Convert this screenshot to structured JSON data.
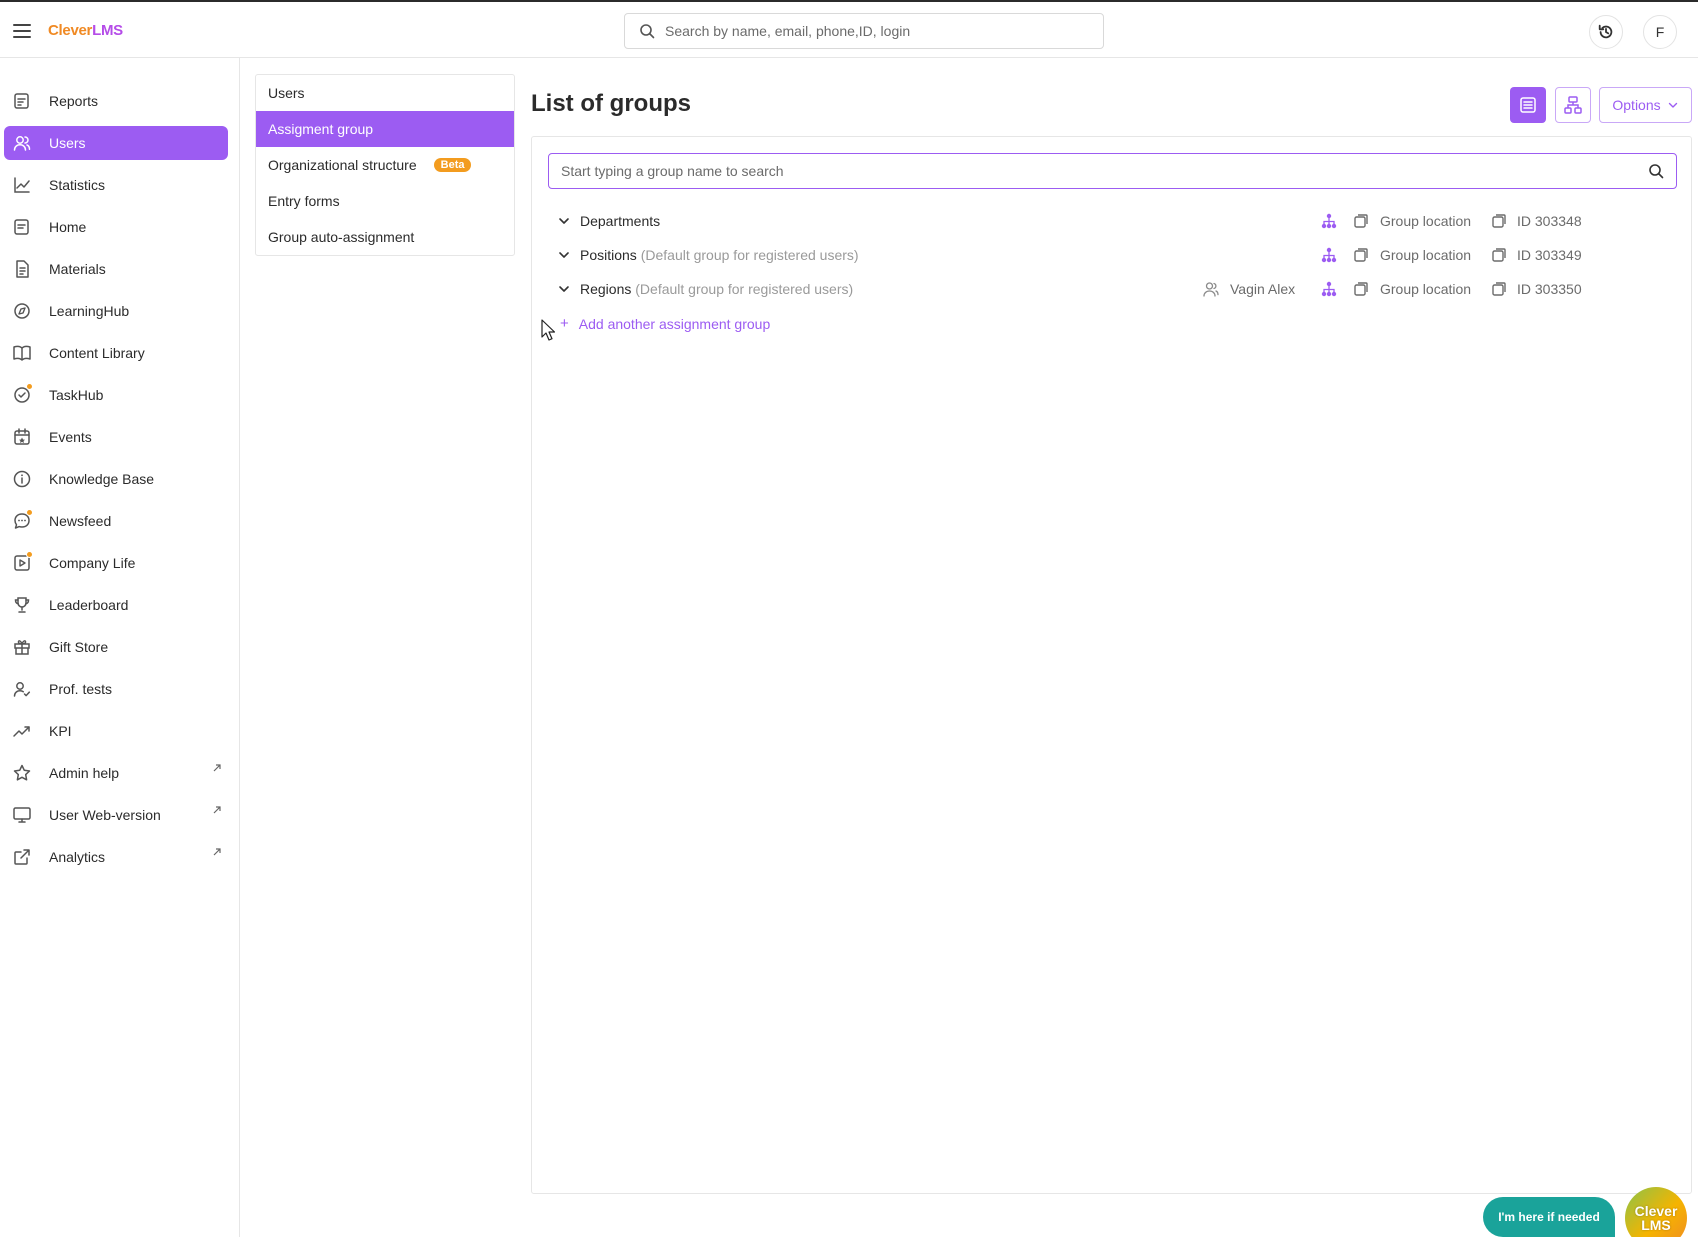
{
  "header": {
    "logo_part1": "Clever",
    "logo_part2": "LMS",
    "search_placeholder": "Search by name, email, phone,ID, login",
    "avatar_initial": "F"
  },
  "sidebar": {
    "items": [
      {
        "label": "Reports",
        "icon": "reports-icon",
        "active": false
      },
      {
        "label": "Users",
        "icon": "users-icon",
        "active": true
      },
      {
        "label": "Statistics",
        "icon": "statistics-icon",
        "active": false
      },
      {
        "label": "Home",
        "icon": "home-icon",
        "active": false
      },
      {
        "label": "Materials",
        "icon": "materials-icon",
        "active": false
      },
      {
        "label": "LearningHub",
        "icon": "learninghub-icon",
        "active": false
      },
      {
        "label": "Content Library",
        "icon": "book-icon",
        "active": false
      },
      {
        "label": "TaskHub",
        "icon": "taskhub-icon",
        "active": false
      },
      {
        "label": "Events",
        "icon": "calendar-icon",
        "active": false
      },
      {
        "label": "Knowledge Base",
        "icon": "info-icon",
        "active": false
      },
      {
        "label": "Newsfeed",
        "icon": "chat-icon",
        "active": false
      },
      {
        "label": "Company Life",
        "icon": "video-icon",
        "active": false
      },
      {
        "label": "Leaderboard",
        "icon": "trophy-icon",
        "active": false
      },
      {
        "label": "Gift Store",
        "icon": "gift-icon",
        "active": false
      },
      {
        "label": "Prof. tests",
        "icon": "user-check-icon",
        "active": false
      },
      {
        "label": "KPI",
        "icon": "trend-icon",
        "active": false
      },
      {
        "label": "Admin help",
        "icon": "star-icon",
        "active": false
      },
      {
        "label": "User Web-version",
        "icon": "monitor-icon",
        "active": false
      },
      {
        "label": "Analytics",
        "icon": "external-link-icon",
        "active": false
      }
    ]
  },
  "submenu": {
    "items": [
      {
        "label": "Users"
      },
      {
        "label": "Assigment group"
      },
      {
        "label": "Organizational structure",
        "badge": "Beta"
      },
      {
        "label": "Entry forms"
      },
      {
        "label": "Group auto-assignment"
      }
    ]
  },
  "main": {
    "title": "List of groups",
    "options_label": "Options",
    "group_search_placeholder": "Start typing a group name to search",
    "groups": [
      {
        "name": "Departments",
        "note": "",
        "owner": "",
        "location": "Group location",
        "id": "ID 303348"
      },
      {
        "name": "Positions",
        "note": "(Default group for registered users)",
        "owner": "",
        "location": "Group location",
        "id": "ID 303349"
      },
      {
        "name": "Regions",
        "note": "(Default group for registered users)",
        "owner": "Vagin Alex",
        "location": "Group location",
        "id": "ID 303350"
      }
    ],
    "add_group_label": "Add another assignment group"
  },
  "widgets": {
    "help_label": "I'm here if needed",
    "bot_line1": "Clever",
    "bot_line2": "LMS"
  },
  "colors": {
    "accent": "#9c5cf2",
    "badge": "#f39c1f",
    "help": "#1aa39a"
  }
}
